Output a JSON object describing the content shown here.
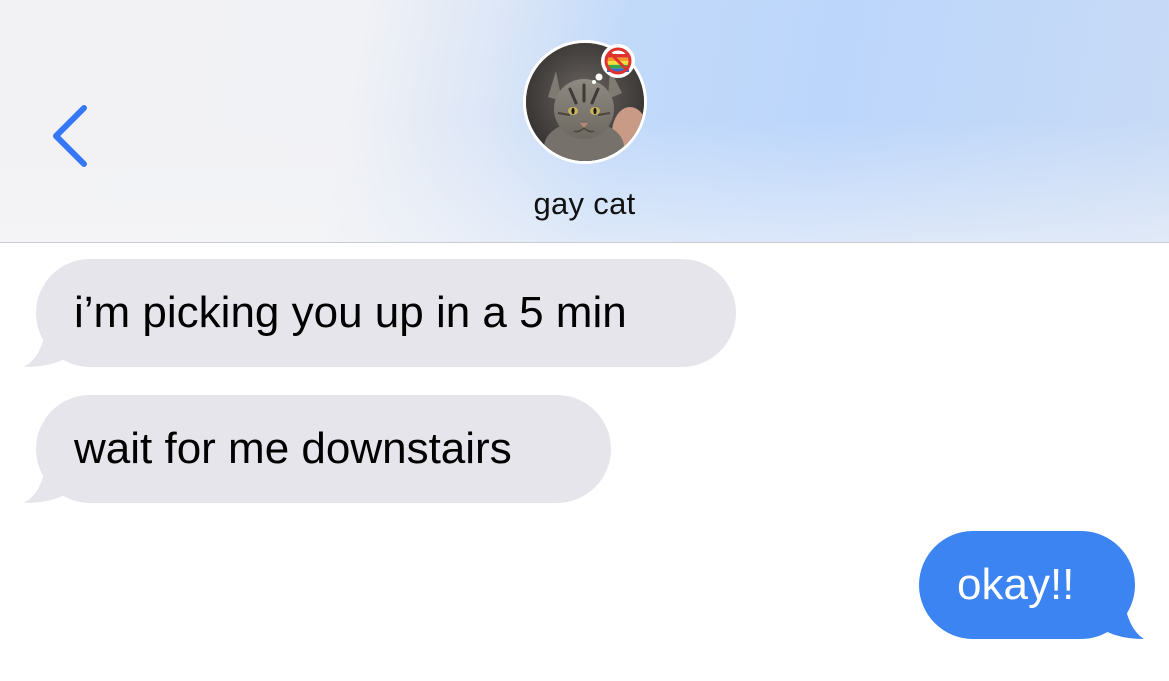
{
  "header": {
    "contact_name": "gay cat",
    "back_icon": "chevron-left-icon",
    "avatar_icon": "cat-photo-avatar",
    "thought_icon": "no-rainbow-thought-bubble",
    "accent_color": "#3478f6"
  },
  "messages": [
    {
      "direction": "incoming",
      "text": "i’m picking you up in a 5 min"
    },
    {
      "direction": "incoming",
      "text": "wait for me downstairs"
    },
    {
      "direction": "outgoing",
      "text": "okay!!"
    }
  ],
  "colors": {
    "incoming_bubble": "#e6e5eb",
    "outgoing_bubble": "#3b84f2",
    "outgoing_text": "#ffffff"
  }
}
